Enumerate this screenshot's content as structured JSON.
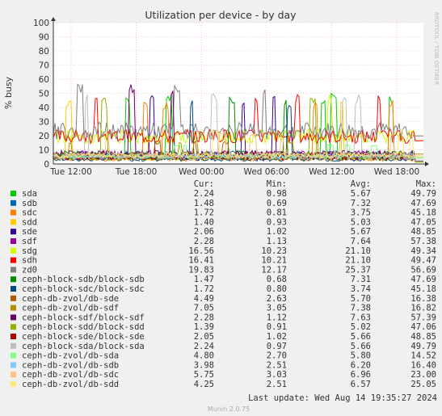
{
  "chart_data": {
    "type": "line",
    "title": "Utilization per device - by day",
    "ylabel": "% busy",
    "ylim": [
      0,
      100
    ],
    "yticks": [
      "0",
      "10",
      "20",
      "30",
      "40",
      "50",
      "60",
      "70",
      "80",
      "90",
      "100"
    ],
    "xticks": [
      "Tue 12:00",
      "Tue 18:00",
      "Wed 00:00",
      "Wed 06:00",
      "Wed 12:00",
      "Wed 18:00"
    ],
    "grid": true,
    "side_label": "RRDTOOL / TOBI OETIKER",
    "columns": {
      "cur": "Cur:",
      "min": "Min:",
      "avg": "Avg:",
      "max": "Max:"
    },
    "series": [
      {
        "name": "sda",
        "color": "#00cc00",
        "cur": "2.24",
        "min": "0.98",
        "avg": "5.67",
        "max": "49.79"
      },
      {
        "name": "sdb",
        "color": "#0066b3",
        "cur": "1.48",
        "min": "0.69",
        "avg": "7.32",
        "max": "47.69"
      },
      {
        "name": "sdc",
        "color": "#ff8000",
        "cur": "1.72",
        "min": "0.81",
        "avg": "3.75",
        "max": "45.18"
      },
      {
        "name": "sdd",
        "color": "#ffcc00",
        "cur": "1.40",
        "min": "0.93",
        "avg": "5.03",
        "max": "47.05"
      },
      {
        "name": "sde",
        "color": "#330099",
        "cur": "2.06",
        "min": "1.02",
        "avg": "5.67",
        "max": "48.85"
      },
      {
        "name": "sdf",
        "color": "#990099",
        "cur": "2.28",
        "min": "1.13",
        "avg": "7.64",
        "max": "57.38"
      },
      {
        "name": "sdg",
        "color": "#ccff00",
        "cur": "16.56",
        "min": "10.23",
        "avg": "21.10",
        "max": "49.34"
      },
      {
        "name": "sdh",
        "color": "#ff0000",
        "cur": "16.41",
        "min": "10.21",
        "avg": "21.10",
        "max": "49.47"
      },
      {
        "name": "zd0",
        "color": "#808080",
        "cur": "19.83",
        "min": "12.17",
        "avg": "25.37",
        "max": "56.69"
      },
      {
        "name": "ceph-block-sdb/block-sdb",
        "color": "#008f00",
        "cur": "1.47",
        "min": "0.68",
        "avg": "7.31",
        "max": "47.69"
      },
      {
        "name": "ceph-block-sdc/block-sdc",
        "color": "#00487d",
        "cur": "1.72",
        "min": "0.80",
        "avg": "3.74",
        "max": "45.18"
      },
      {
        "name": "ceph-db-zvol/db-sde",
        "color": "#b35a00",
        "cur": "4.49",
        "min": "2.63",
        "avg": "5.70",
        "max": "16.38"
      },
      {
        "name": "ceph-db-zvol/db-sdf",
        "color": "#b38f00",
        "cur": "7.05",
        "min": "3.05",
        "avg": "7.38",
        "max": "16.82"
      },
      {
        "name": "ceph-block-sdf/block-sdf",
        "color": "#6b006b",
        "cur": "2.28",
        "min": "1.12",
        "avg": "7.63",
        "max": "57.39"
      },
      {
        "name": "ceph-block-sdd/block-sdd",
        "color": "#8fb300",
        "cur": "1.39",
        "min": "0.91",
        "avg": "5.02",
        "max": "47.06"
      },
      {
        "name": "ceph-block-sde/block-sde",
        "color": "#b30000",
        "cur": "2.05",
        "min": "1.02",
        "avg": "5.66",
        "max": "48.85"
      },
      {
        "name": "ceph-block-sda/block-sda",
        "color": "#bebebe",
        "cur": "2.24",
        "min": "0.97",
        "avg": "5.66",
        "max": "49.79"
      },
      {
        "name": "ceph-db-zvol/db-sda",
        "color": "#80ff80",
        "cur": "4.80",
        "min": "2.70",
        "avg": "5.80",
        "max": "14.52"
      },
      {
        "name": "ceph-db-zvol/db-sdb",
        "color": "#80c9ff",
        "cur": "3.98",
        "min": "2.51",
        "avg": "6.20",
        "max": "16.40"
      },
      {
        "name": "ceph-db-zvol/db-sdc",
        "color": "#ffc080",
        "cur": "5.75",
        "min": "3.03",
        "avg": "6.96",
        "max": "23.00"
      },
      {
        "name": "ceph-db-zvol/db-sdd",
        "color": "#ffe680",
        "cur": "4.25",
        "min": "2.51",
        "avg": "6.57",
        "max": "25.05"
      }
    ],
    "last_update": "Last update: Wed Aug 14 19:35:27 2024",
    "footer": "Munin 2.0.75"
  }
}
